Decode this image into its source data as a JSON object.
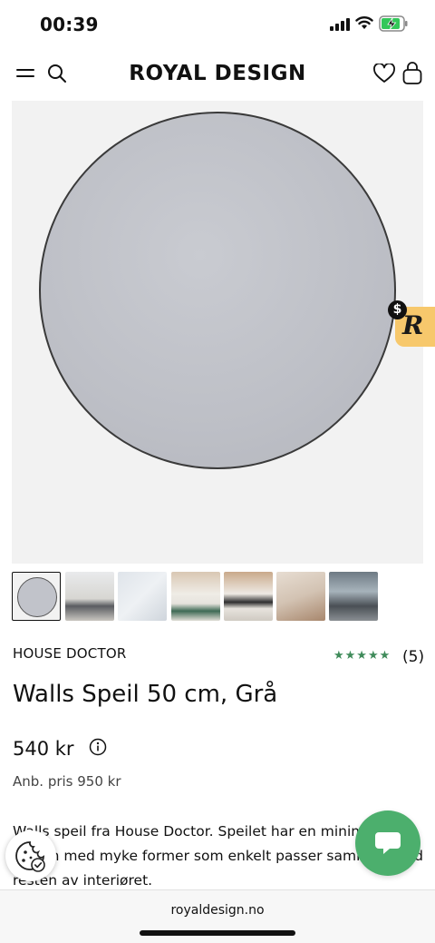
{
  "status_bar": {
    "time": "00:39"
  },
  "header": {
    "logo": "ROYAL DESIGN"
  },
  "product": {
    "brand": "HOUSE DOCTOR",
    "rating": 5,
    "rating_stars": "★★★★★",
    "review_count": "(5)",
    "title": "Walls Speil 50 cm, Grå",
    "price": "540 kr",
    "recommended_price": "Anb. pris 950 kr",
    "description": "Walls speil fra House Doctor. Speilet har en minimalistisk design med myke former som enkelt passer sammen med resten av interiøret."
  },
  "promo_badge": {
    "letter": "R",
    "dollar": "$"
  },
  "browser": {
    "url": "royaldesign.no"
  },
  "colors": {
    "accent_green": "#4caf6d",
    "star_green": "#3f8b5a",
    "promo_yellow": "#f7c86c"
  }
}
